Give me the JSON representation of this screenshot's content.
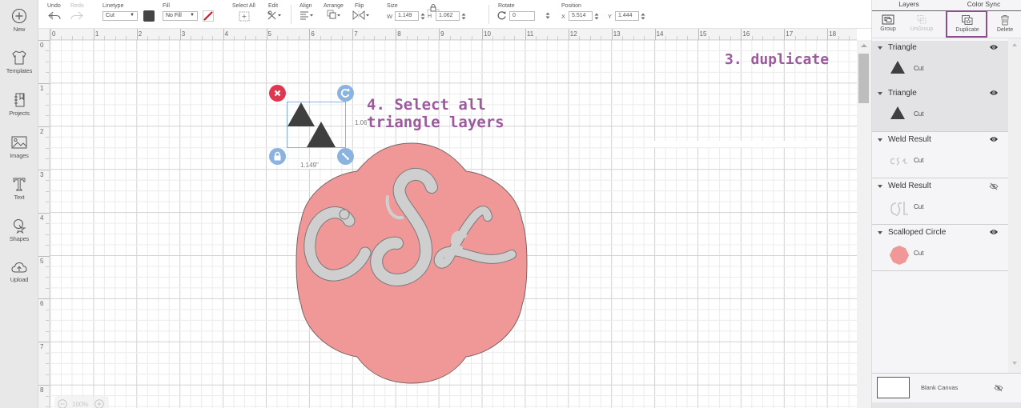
{
  "sidebar": {
    "items": [
      {
        "label": "New",
        "icon": "plus-circle-icon"
      },
      {
        "label": "Templates",
        "icon": "tshirt-icon"
      },
      {
        "label": "Projects",
        "icon": "notebook-icon"
      },
      {
        "label": "Images",
        "icon": "image-icon"
      },
      {
        "label": "Text",
        "icon": "text-t-icon"
      },
      {
        "label": "Shapes",
        "icon": "shapes-icon"
      },
      {
        "label": "Upload",
        "icon": "cloud-upload-icon"
      }
    ]
  },
  "toolbar": {
    "undo_label": "Undo",
    "redo_label": "Redo",
    "linetype_label": "Linetype",
    "linetype_value": "Cut",
    "linetype_color": "#444444",
    "fill_label": "Fill",
    "fill_value": "No Fill",
    "select_all_label": "Select All",
    "edit_label": "Edit",
    "align_label": "Align",
    "arrange_label": "Arrange",
    "flip_label": "Flip",
    "size_label": "Size",
    "width_axis": "W",
    "width_value": "1.149",
    "height_axis": "H",
    "height_value": "1.062",
    "rotate_label": "Rotate",
    "rotate_value": "0",
    "position_label": "Position",
    "x_axis": "X",
    "x_value": "5.514",
    "y_axis": "Y",
    "y_value": "1.444"
  },
  "canvas": {
    "h_ruler": [
      "0",
      "1",
      "2",
      "3",
      "4",
      "5",
      "6",
      "7",
      "8",
      "9",
      "10",
      "11",
      "12",
      "13",
      "14",
      "15",
      "16",
      "17",
      "18"
    ],
    "v_ruler": [
      "0",
      "1",
      "2",
      "3",
      "4",
      "5",
      "6",
      "7",
      "8"
    ],
    "selection_width_label": "1.149\"",
    "selection_height_label": "1.062\"",
    "zoom_level": "100%",
    "annotation_select": "4. Select all\ntriangle layers",
    "annotation_select_line1": "4. Select all",
    "annotation_select_line2": "triangle layers",
    "annotation_duplicate": "3. duplicate",
    "monogram_text": "CSL",
    "colors": {
      "scallop_fill": "#f09898",
      "monogram_fill": "#cfcfcf",
      "triangle_fill": "#3f3f3f",
      "handle_delete": "#e0364f",
      "handle_blue": "#8bb3e0",
      "annotation": "#9a5a9c"
    }
  },
  "panel": {
    "tabs": [
      "Layers",
      "Color Sync"
    ],
    "actions": [
      {
        "label": "Group",
        "enabled": true
      },
      {
        "label": "UnGroup",
        "enabled": false
      },
      {
        "label": "Duplicate",
        "enabled": true,
        "highlighted": true
      },
      {
        "label": "Delete",
        "enabled": true
      }
    ],
    "layers": [
      {
        "name": "Triangle",
        "operation": "Cut",
        "visible": true,
        "selected": true,
        "thumb": "triangle"
      },
      {
        "name": "Triangle",
        "operation": "Cut",
        "visible": true,
        "selected": true,
        "thumb": "triangle"
      },
      {
        "name": "Weld Result",
        "operation": "Cut",
        "visible": true,
        "selected": false,
        "thumb": "c&l-script"
      },
      {
        "name": "Weld Result",
        "operation": "Cut",
        "visible": false,
        "selected": false,
        "thumb": "csl-script"
      },
      {
        "name": "Scalloped Circle",
        "operation": "Cut",
        "visible": true,
        "selected": false,
        "thumb": "pink-scallop"
      }
    ],
    "blank_canvas_label": "Blank Canvas"
  }
}
